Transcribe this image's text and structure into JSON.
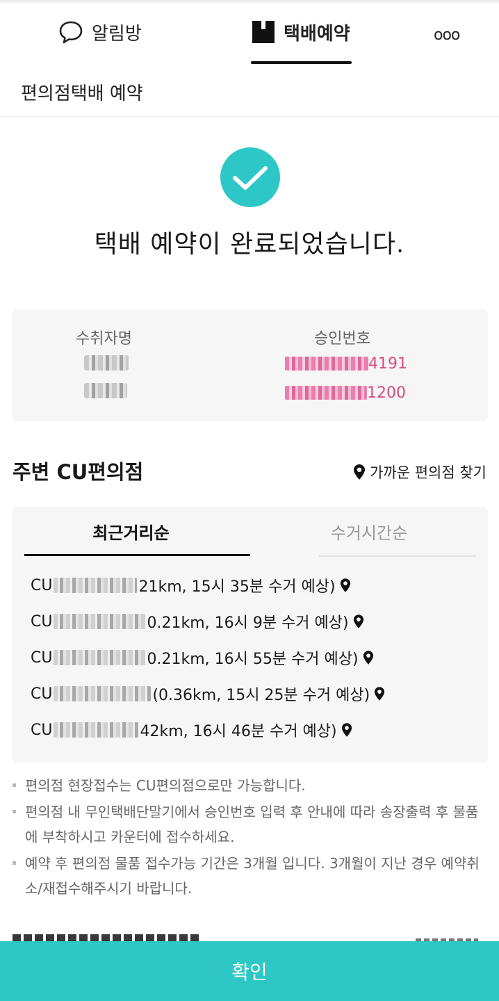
{
  "tabs": {
    "chat_label": "알림방",
    "parcel_label": "택배예약",
    "more_label": "ooo"
  },
  "subheader": {
    "title": "편의점택배 예약"
  },
  "completion": {
    "message": "택배 예약이 완료되었습니다."
  },
  "info": {
    "recipient_header": "수취자명",
    "approval_header": "승인번호",
    "approval_suffixes": [
      "4191",
      "1200"
    ]
  },
  "nearby": {
    "title": "주변 CU편의점",
    "find_label": "가까운 편의점 찾기",
    "sort_recent": "최근거리순",
    "sort_time": "수거시간순",
    "stores": [
      {
        "prefix": "CU",
        "detail": "21km, 15시 35분 수거 예상)"
      },
      {
        "prefix": "CU",
        "detail": "0.21km, 16시 9분 수거 예상)"
      },
      {
        "prefix": "CU",
        "detail": "0.21km, 16시 55분 수거 예상)"
      },
      {
        "prefix": "CU",
        "detail": "(0.36km, 15시 25분 수거 예상)"
      },
      {
        "prefix": "CU",
        "detail": "42km, 16시 46분 수거 예상)"
      }
    ]
  },
  "notes": [
    "편의점 현장접수는 CU편의점으로만 가능합니다.",
    "편의점 내 무인택배단말기에서 승인번호 입력 후 안내에 따라 송장출력 후 물품에 부착하시고 카운터에 접수하세요.",
    "예약 후 편의점 물품 접수가능 기간은 3개월 입니다. 3개월이 지난 경우 예약취소/재접수해주시기 바랍니다."
  ],
  "confirm_label": "확인",
  "colors": {
    "accent": "#2dc7c4",
    "pink": "#d94b82"
  }
}
